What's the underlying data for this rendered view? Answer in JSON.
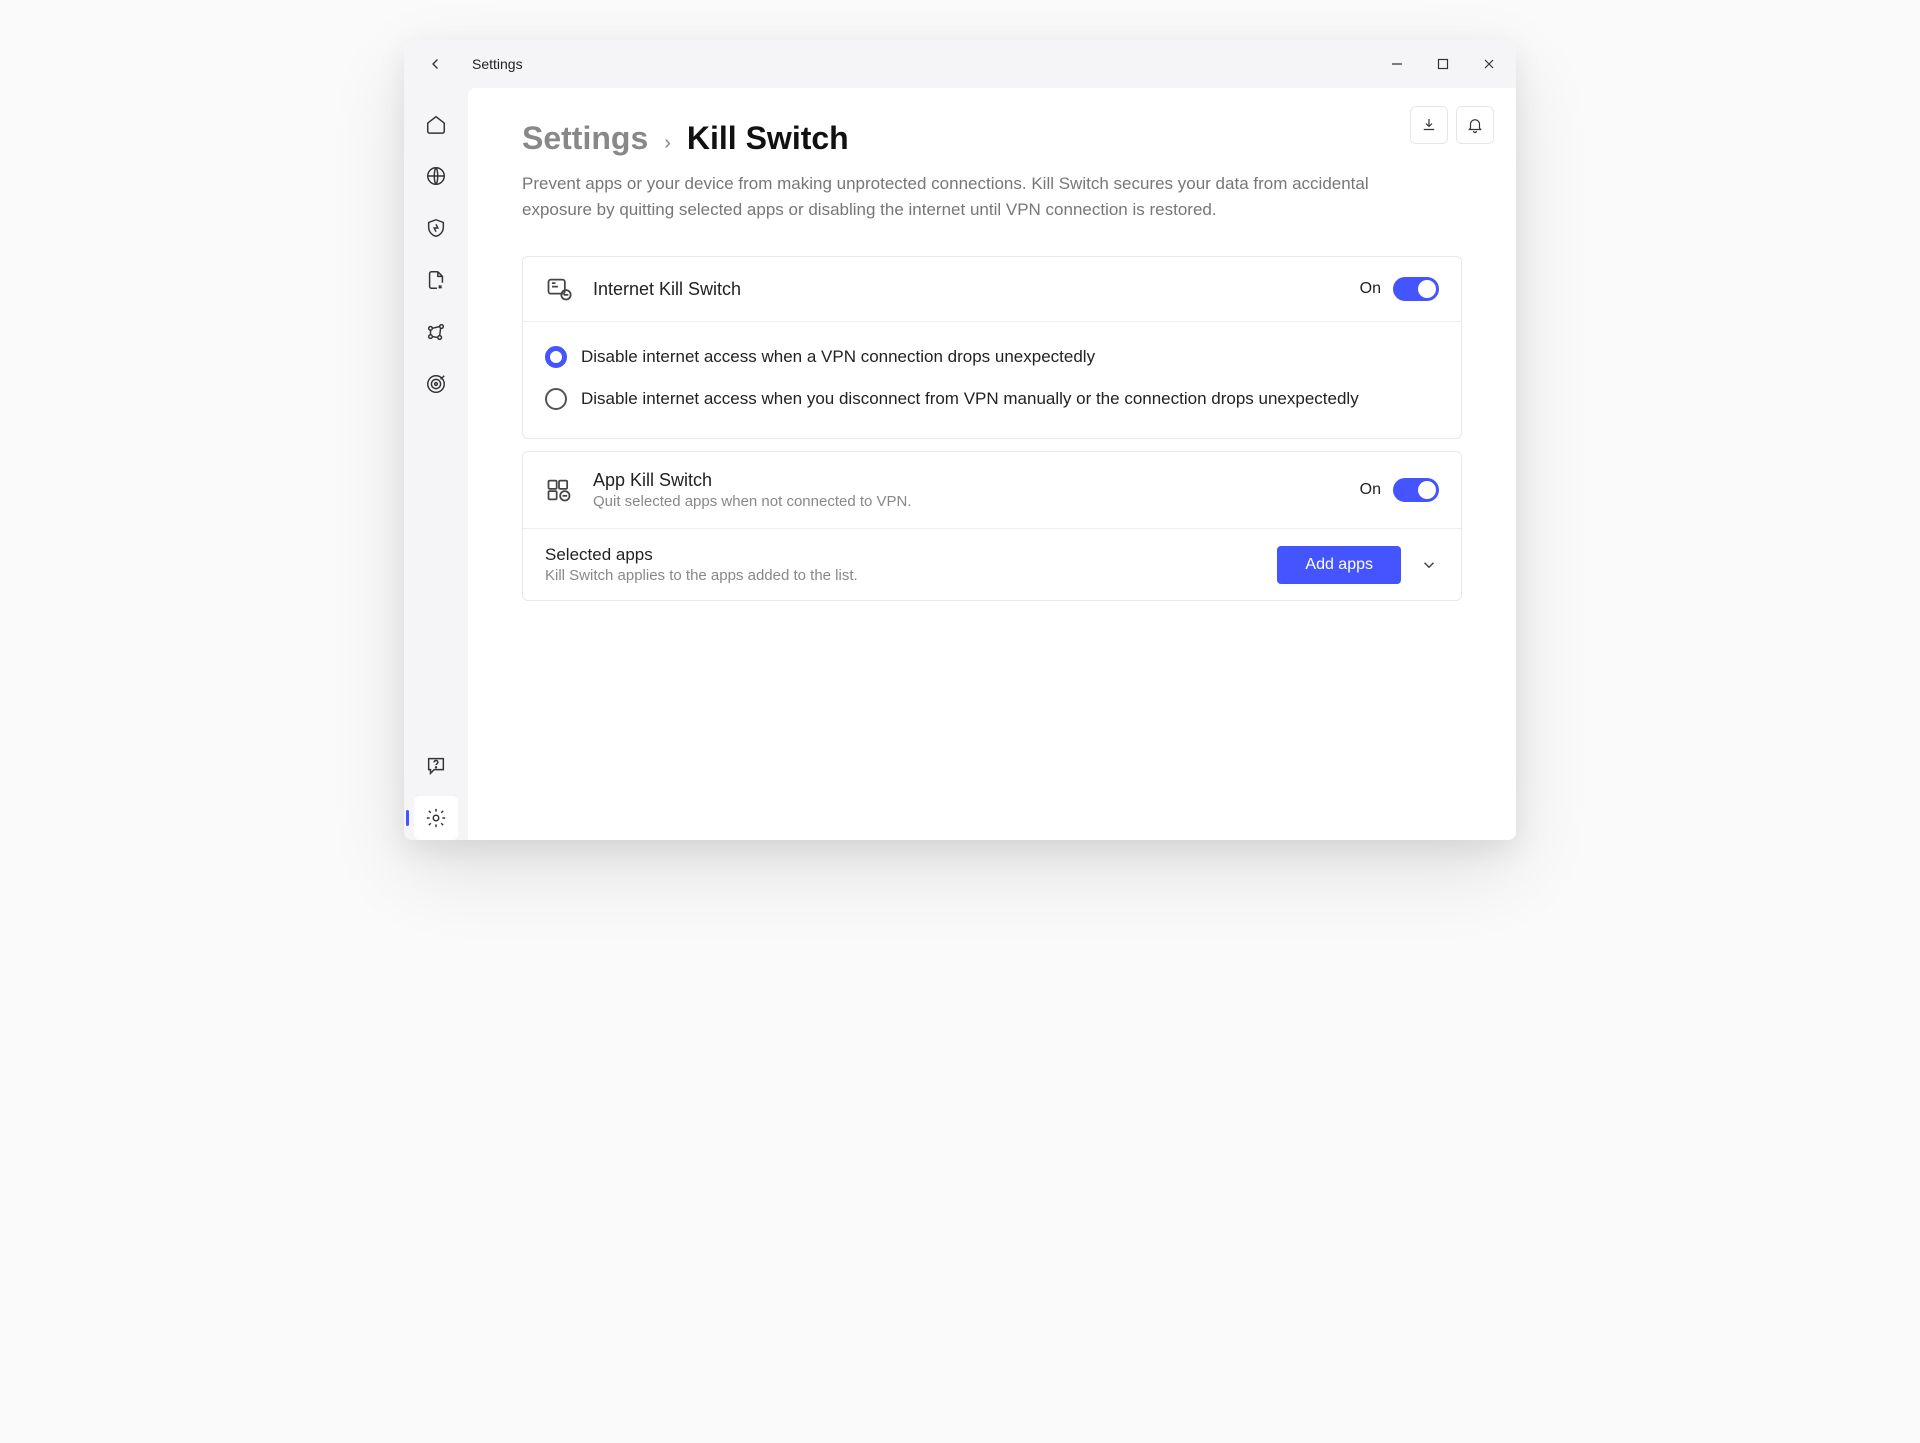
{
  "window": {
    "title": "Settings"
  },
  "breadcrumb": {
    "parent": "Settings",
    "sep": "›",
    "current": "Kill Switch"
  },
  "description": "Prevent apps or your device from making unprotected connections. Kill Switch secures your data from accidental exposure by quitting selected apps or disabling the internet until VPN connection is restored.",
  "internet_ks": {
    "title": "Internet Kill Switch",
    "state_label": "On",
    "option1": "Disable internet access when a VPN connection drops unexpectedly",
    "option2": "Disable internet access when you disconnect from VPN manually or the connection drops unexpectedly"
  },
  "app_ks": {
    "title": "App Kill Switch",
    "subtitle": "Quit selected apps when not connected to VPN.",
    "state_label": "On",
    "selected_title": "Selected apps",
    "selected_sub": "Kill Switch applies to the apps added to the list.",
    "add_button": "Add apps"
  }
}
